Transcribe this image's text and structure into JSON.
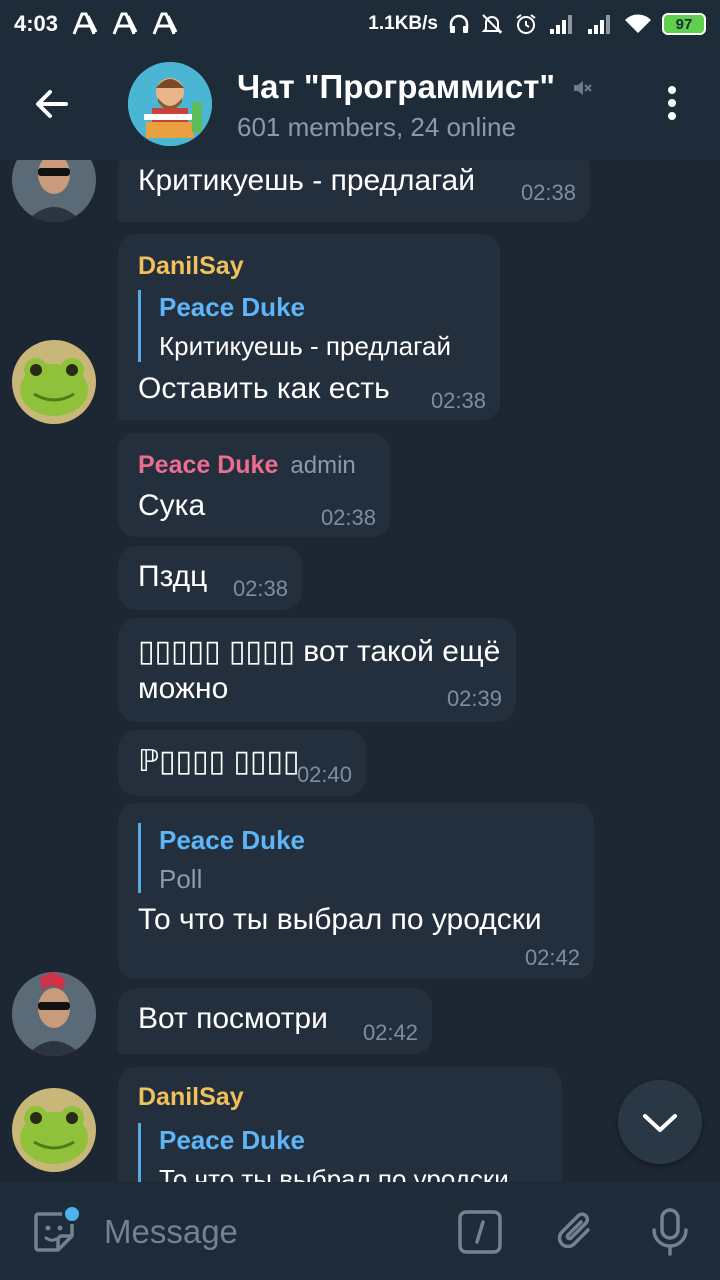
{
  "status_bar": {
    "time": "4:03",
    "net_speed": "1.1KB/s",
    "battery": "97",
    "notification_icons": [
      "a-icon",
      "a-icon",
      "a-icon"
    ]
  },
  "header": {
    "title": "Чат \"Программист\"",
    "subtitle": "601 members, 24 online"
  },
  "messages": [
    {
      "id": "m1",
      "text": "Критикуешь - предлагай",
      "time": "02:38"
    },
    {
      "id": "m2",
      "sender": "DanilSay",
      "reply_name": "Peace Duke",
      "reply_text": "Критикуешь - предлагай",
      "text": "Оставить как есть",
      "time": "02:38"
    },
    {
      "id": "m3",
      "sender": "Peace Duke",
      "badge": "admin",
      "text": "Сука",
      "time": "02:38"
    },
    {
      "id": "m4",
      "text": "Пздц",
      "time": "02:38"
    },
    {
      "id": "m5",
      "text_line1": "▯▯▯▯▯ ▯▯▯▯ вот такой ещё",
      "text_line2": "можно",
      "time": "02:39"
    },
    {
      "id": "m6",
      "text": "ℙ▯▯▯▯ ▯▯▯▯",
      "time": "02:40"
    },
    {
      "id": "m7",
      "reply_name": "Peace Duke",
      "reply_text": "Poll",
      "text": "То что ты выбрал по уродски",
      "time": "02:42"
    },
    {
      "id": "m8",
      "text": "Вот посмотри",
      "time": "02:42"
    },
    {
      "id": "m9",
      "sender": "DanilSay",
      "reply_name": "Peace Duke",
      "reply_text": "То что ты выбрал по уродски"
    }
  ],
  "input": {
    "placeholder": "Message"
  },
  "colors": {
    "background": "#1d2733",
    "bar": "#1e2c3a",
    "bubble": "#232f3c",
    "sender_yellow": "#f0c05a",
    "sender_pink": "#ee6d8f",
    "reply_accent": "#5eb5f7"
  }
}
